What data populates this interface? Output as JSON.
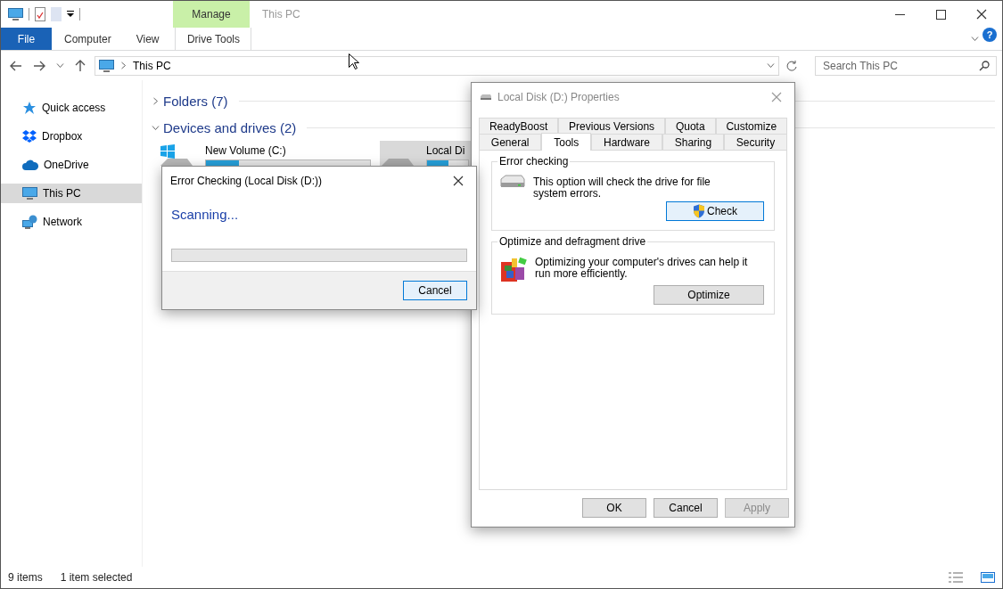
{
  "window": {
    "title": "This PC"
  },
  "contextual_group": "Manage",
  "help_button": "?",
  "ribbon_tabs": [
    {
      "label": "File",
      "kind": "file"
    },
    {
      "label": "Computer",
      "kind": "plain"
    },
    {
      "label": "View",
      "kind": "plain"
    },
    {
      "label": "Drive Tools",
      "kind": "contextual"
    }
  ],
  "address_bar": {
    "path": "This PC"
  },
  "search": {
    "placeholder": "Search This PC"
  },
  "sidebar": {
    "items": [
      {
        "label": "Quick access",
        "kind": "star",
        "selected": false
      },
      {
        "label": "Dropbox",
        "kind": "dropbox",
        "selected": false
      },
      {
        "label": "OneDrive",
        "kind": "cloud",
        "selected": false
      },
      {
        "label": "This PC",
        "kind": "pc",
        "selected": true
      },
      {
        "label": "Network",
        "kind": "network",
        "selected": false
      }
    ]
  },
  "groups": [
    {
      "title": "Folders (7)",
      "expanded": false
    },
    {
      "title": "Devices and drives (2)",
      "expanded": true
    }
  ],
  "drives": [
    {
      "name": "New Volume (C:)",
      "kind": "system",
      "level": 0.2,
      "selected": false
    },
    {
      "name": "Local Di",
      "kind": "disk",
      "level": 0.53,
      "selected": true
    }
  ],
  "error_dialog": {
    "title": "Error Checking (Local Disk (D:))",
    "status": "Scanning...",
    "level": 0,
    "button": "Cancel"
  },
  "properties_dialog": {
    "title": "Local Disk (D:) Properties",
    "tab_rows": [
      [
        {
          "label": "ReadyBoost",
          "selected": false
        },
        {
          "label": "Previous Versions",
          "selected": false
        },
        {
          "label": "Quota",
          "selected": false
        },
        {
          "label": "Customize",
          "selected": false
        }
      ],
      [
        {
          "label": "General",
          "selected": false
        },
        {
          "label": "Tools",
          "selected": true
        },
        {
          "label": "Hardware",
          "selected": false
        },
        {
          "label": "Sharing",
          "selected": false
        },
        {
          "label": "Security",
          "selected": false
        }
      ]
    ],
    "sections": [
      {
        "title": "Error checking",
        "kind": "disk",
        "text": "This option will check the drive for file system errors.",
        "button": {
          "label": "Check",
          "shield": true,
          "focused": true
        }
      },
      {
        "title": "Optimize and defragment drive",
        "kind": "defrag",
        "text": "Optimizing your computer's drives can help it run more efficiently.",
        "button": {
          "label": "Optimize",
          "shield": false,
          "focused": false
        }
      }
    ],
    "buttons": [
      {
        "label": "OK",
        "disabled": false
      },
      {
        "label": "Cancel",
        "disabled": false
      },
      {
        "label": "Apply",
        "disabled": true
      }
    ]
  },
  "status_bar": {
    "count": "9 items",
    "selection": "1 item selected"
  }
}
